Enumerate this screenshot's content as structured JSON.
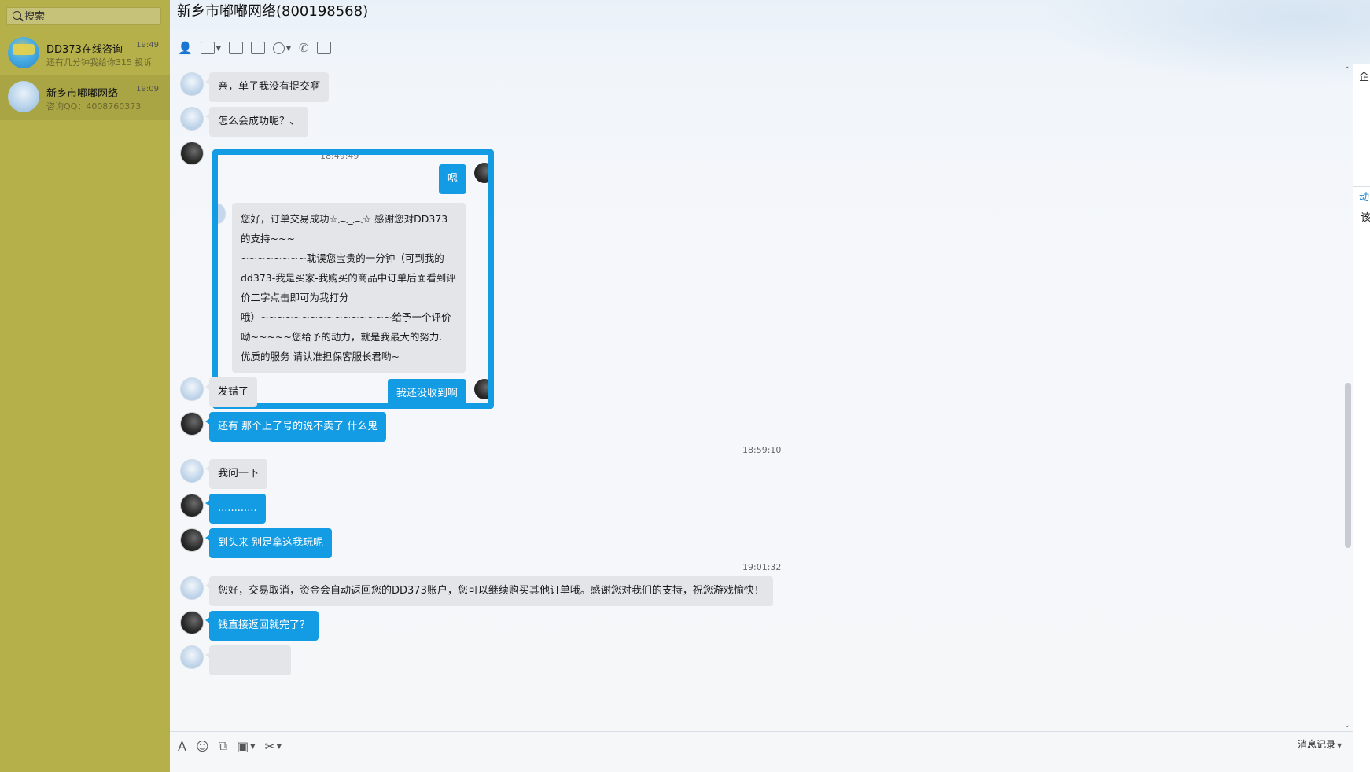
{
  "sidebar": {
    "search_placeholder": "搜索",
    "contacts": [
      {
        "name": "DD373在线咨询",
        "time": "19:49",
        "preview": "还有几分钟我给你315 投诉"
      },
      {
        "name": "新乡市嘟嘟网络",
        "time": "19:09",
        "preview": "咨询QQ：4008760373"
      }
    ]
  },
  "chat": {
    "title": "新乡市嘟嘟网络(800198568)",
    "toolbar": [
      "contact-icon",
      "transfer-file-icon",
      "remote-desktop-icon",
      "document-icon",
      "app-icon",
      "phone-icon",
      "video-icon"
    ],
    "quote": {
      "time": "18:49:49",
      "me1": "嗯",
      "them": [
        "您好，订单交易成功☆︵_︵☆ 感谢您对DD373的支持~~~",
        "~~~~~~~~耽误您宝贵的一分钟（可到我的dd373-我是买家-我购买的商品中订单后面看到评价二字点击即可为我打分",
        "哦）~~~~~~~~~~~~~~~~给予一个评价呦~~~~~您给予的动力，就是我最大的努力.",
        "优质的服务 请认准担保客服长君哟~"
      ],
      "me2": "我还没收到啊"
    },
    "messages": {
      "m1": "亲，单子我没有提交啊",
      "m2": "怎么会成功呢？、",
      "m3": "发错了",
      "m4": "还有 那个上了号的说不卖了 什么鬼",
      "ts1": "18:59:10",
      "m5": "我问一下",
      "m6": "............",
      "m7": "到头来 别是拿这我玩呢",
      "ts2": "19:01:32",
      "m8": "您好，交易取消，资金会自动返回您的DD373账户，您可以继续购买其他订单哦。感谢您对我们的支持，祝您游戏愉快！",
      "m9": "钱直接返回就完了？"
    },
    "input_toolbar": [
      "font-icon",
      "emoji-icon",
      "shake-icon",
      "image-icon",
      "screenshot-icon"
    ],
    "history_label": "消息记录"
  },
  "right_panel": {
    "c1": "企",
    "c2": "动",
    "c3": "该"
  }
}
